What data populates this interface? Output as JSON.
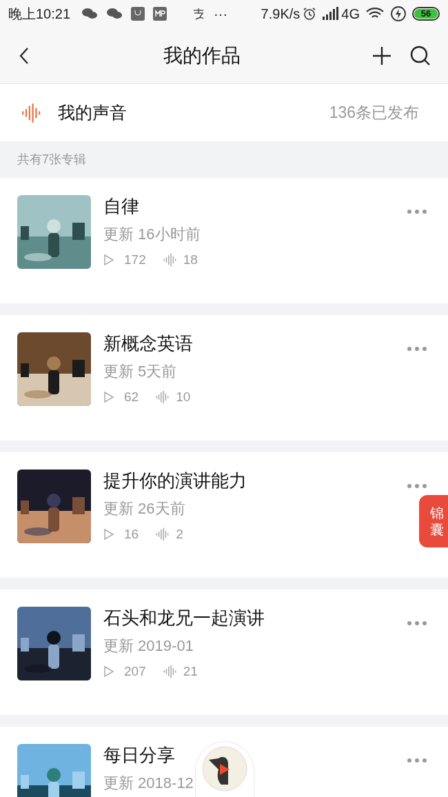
{
  "status_bar": {
    "time": "晚上10:21",
    "more": "···",
    "speed": "7.9K/s",
    "network": "4G",
    "battery": "56"
  },
  "header": {
    "title": "我的作品"
  },
  "voice": {
    "label": "我的声音",
    "count": "136条已发布"
  },
  "section": {
    "label": "共有7张专辑"
  },
  "albums": [
    {
      "title": "自律",
      "updated": "更新 16小时前",
      "plays": "172",
      "tracks": "18"
    },
    {
      "title": "新概念英语",
      "updated": "更新 5天前",
      "plays": "62",
      "tracks": "10"
    },
    {
      "title": "提升你的演讲能力",
      "updated": "更新 26天前",
      "plays": "16",
      "tracks": "2"
    },
    {
      "title": "石头和龙兄一起演讲",
      "updated": "更新 2019-01",
      "plays": "207",
      "tracks": "21"
    },
    {
      "title": "每日分享",
      "updated": "更新 2018-12"
    }
  ],
  "float_badge": {
    "label": "锦囊"
  }
}
